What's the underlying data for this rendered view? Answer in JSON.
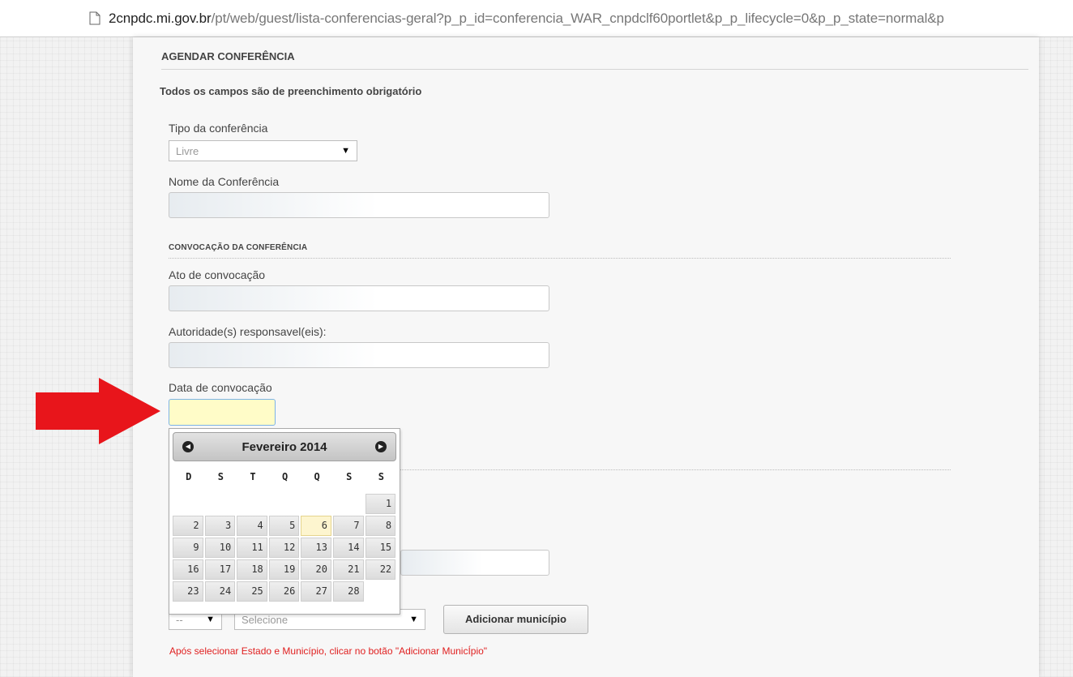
{
  "browser": {
    "url_host": "2cnpdc.mi.gov.br",
    "url_path": "/pt/web/guest/lista-conferencias-geral?p_p_id=conferencia_WAR_cnpdclf60portlet&p_p_lifecycle=0&p_p_state=normal&p"
  },
  "form": {
    "title": "AGENDAR CONFERÊNCIA",
    "required_note": "Todos os campos são de preenchimento obrigatório",
    "tipo_label": "Tipo da conferência",
    "tipo_value": "Livre",
    "nome_label": "Nome da Conferência",
    "convocacao_section": "CONVOCAÇÃO DA CONFERÊNCIA",
    "ato_label": "Ato de convocação",
    "autoridade_label": "Autoridade(s) responsavel(eis):",
    "data_label": "Data de convocação",
    "estado_value": "--",
    "municipio_placeholder": "Selecione",
    "add_button": "Adicionar município",
    "warning": "Após selecionar Estado e Município, clicar no botão \"Adicionar MunicÍpio\""
  },
  "datepicker": {
    "month_label": "Fevereiro 2014",
    "weekdays": [
      "D",
      "S",
      "T",
      "Q",
      "Q",
      "S",
      "S"
    ],
    "weeks": [
      [
        "",
        "",
        "",
        "",
        "",
        "",
        "1"
      ],
      [
        "2",
        "3",
        "4",
        "5",
        "6",
        "7",
        "8"
      ],
      [
        "9",
        "10",
        "11",
        "12",
        "13",
        "14",
        "15"
      ],
      [
        "16",
        "17",
        "18",
        "19",
        "20",
        "21",
        "22"
      ],
      [
        "23",
        "24",
        "25",
        "26",
        "27",
        "28",
        ""
      ]
    ],
    "today": "6",
    "prev_icon": "circle-left-icon",
    "next_icon": "circle-right-icon"
  },
  "annotation": {
    "color": "#e8151b"
  }
}
